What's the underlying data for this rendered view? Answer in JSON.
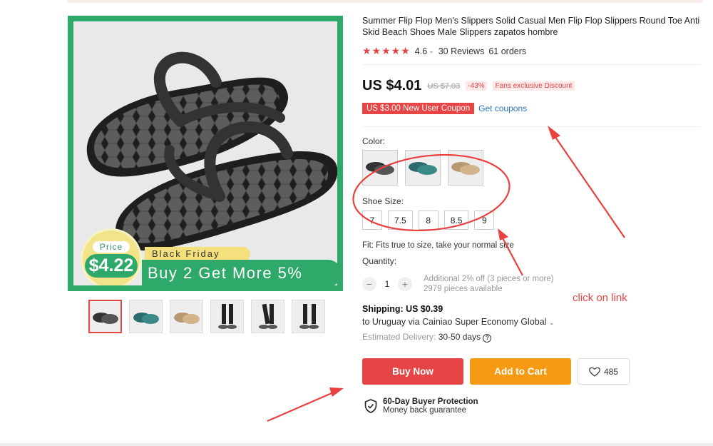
{
  "product": {
    "title": "Summer Flip Flop Men's Slippers Solid Casual Men Flip Flop Slippers Round Toe Anti Skid Beach Shoes Male Slippers zapatos hombre",
    "stars": "★★★★★",
    "rating": "4.6",
    "reviews": "30 Reviews",
    "orders": "61 orders"
  },
  "image_overlay": {
    "price_label": "Price",
    "price_value": "$4.22",
    "black_friday": "Black Friday",
    "promo": "Buy 2 Get More 5%"
  },
  "price": {
    "current": "US $4.01",
    "original": "US $7.03",
    "discount": "-43%",
    "fans_tag": "Fans exclusive Discount",
    "coupon": "US $3.00 New User Coupon",
    "get_coupons": "Get coupons"
  },
  "options": {
    "color_label": "Color:",
    "color_names": [
      "black-gray",
      "teal",
      "khaki"
    ],
    "size_label": "Shoe Size:",
    "sizes": [
      "7",
      "7.5",
      "8",
      "8.5",
      "9"
    ],
    "fit_text": "Fit: Fits true to size, take your normal size"
  },
  "quantity": {
    "label": "Quantity:",
    "minus": "−",
    "value": "1",
    "plus": "+",
    "discount_note": "Additional 2% off (3 pieces or more)",
    "available": "2979 pieces available"
  },
  "shipping": {
    "title": "Shipping: US $0.39",
    "to": "to Uruguay via Cainiao Super Economy Global",
    "est_label": "Estimated Delivery:",
    "est_value": "30-50 days",
    "help": "?"
  },
  "actions": {
    "buy_now": "Buy Now",
    "add_to_cart": "Add to Cart",
    "wishlist_count": "485"
  },
  "protection": {
    "title": "60-Day Buyer Protection",
    "subtitle": "Money back guarantee"
  },
  "annotation": {
    "text": "click on link",
    "color": "#e64545"
  },
  "colors": {
    "accent_red": "#e64545",
    "cart_orange": "#f59a12",
    "promo_green": "#2fa96a",
    "link_blue": "#2a78c4"
  }
}
